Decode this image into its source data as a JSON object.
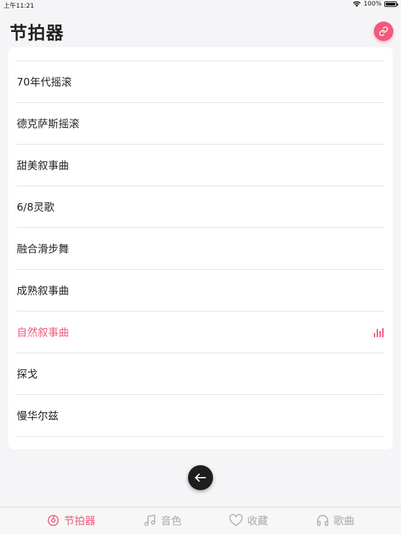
{
  "status_bar": {
    "time": "上午11:21",
    "battery_percent": "100%",
    "battery_level": 1.0
  },
  "header": {
    "title": "节拍器",
    "link_icon": "link-icon"
  },
  "list": {
    "items": [
      {
        "label": "70年代摇滚"
      },
      {
        "label": "德克萨斯摇滚"
      },
      {
        "label": "甜美叙事曲"
      },
      {
        "label": "6/8灵歌"
      },
      {
        "label": "融合滑步舞"
      },
      {
        "label": "成熟叙事曲"
      },
      {
        "label": "自然叙事曲",
        "active": true
      },
      {
        "label": "探戈"
      },
      {
        "label": "慢华尔兹"
      }
    ],
    "active_color": "#f05a7e"
  },
  "back_button": {
    "icon": "arrow-left-icon"
  },
  "tab_bar": {
    "tabs": [
      {
        "label": "节拍器",
        "icon": "metronome-icon",
        "selected": true
      },
      {
        "label": "音色",
        "icon": "music-note-icon",
        "selected": false
      },
      {
        "label": "收藏",
        "icon": "heart-icon",
        "selected": false
      },
      {
        "label": "歌曲",
        "icon": "headphones-icon",
        "selected": false
      }
    ],
    "accent_color": "#f05a7e",
    "inactive_color": "#a9a9a9"
  }
}
